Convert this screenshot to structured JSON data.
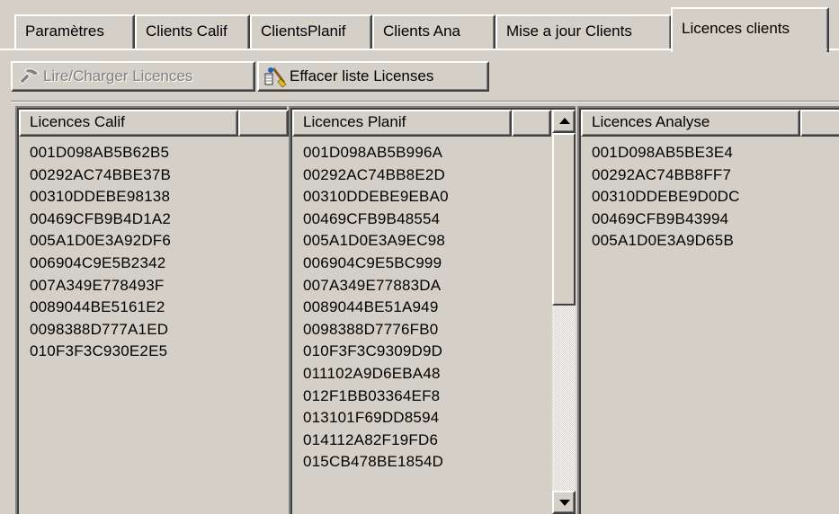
{
  "tabs": [
    {
      "label": "Paramètres",
      "active": false
    },
    {
      "label": "Clients Calif",
      "active": false
    },
    {
      "label": "ClientsPlanif",
      "active": false
    },
    {
      "label": "Clients Ana",
      "active": false
    },
    {
      "label": "Mise a jour Clients",
      "active": false
    },
    {
      "label": "Licences clients",
      "active": true
    }
  ],
  "toolbar": {
    "load_label": "Lire/Charger Licences",
    "load_icon": "pickaxe-icon",
    "load_enabled": false,
    "clear_label": "Effacer liste Licenses",
    "clear_icon": "broom-icon"
  },
  "lists": {
    "calif": {
      "header": "Licences Calif",
      "items": [
        "001D098AB5B62B5",
        "00292AC74BBE37B",
        "00310DDEBE98138",
        "00469CFB9B4D1A2",
        "005A1D0E3A92DF6",
        "006904C9E5B2342",
        "007A349E778493F",
        "0089044BE5161E2",
        "0098388D777A1ED",
        "010F3F3C930E2E5"
      ]
    },
    "planif": {
      "header": "Licences Planif",
      "items": [
        "001D098AB5B996A",
        "00292AC74BB8E2D",
        "00310DDEBE9EBA0",
        "00469CFB9B48554",
        "005A1D0E3A9EC98",
        "006904C9E5BC999",
        "007A349E77883DA",
        "0089044BE51A949",
        "0098388D7776FB0",
        "010F3F3C9309D9D",
        "011102A9D6EBA48",
        "012F1BB03364EF8",
        "013101F69DD8594",
        "014112A82F19FD6",
        "015CB478BE1854D"
      ]
    },
    "analyse": {
      "header": "Licences Analyse",
      "items": [
        "001D098AB5BE3E4",
        "00292AC74BB8FF7",
        "00310DDEBE9D0DC",
        "00469CFB9B43994",
        "005A1D0E3A9D65B"
      ]
    }
  },
  "colors": {
    "face": "#d4d0c8",
    "highlight": "#ffffff",
    "shadow": "#808080",
    "dark_shadow": "#404040",
    "text": "#000000",
    "disabled_text": "#808080"
  }
}
